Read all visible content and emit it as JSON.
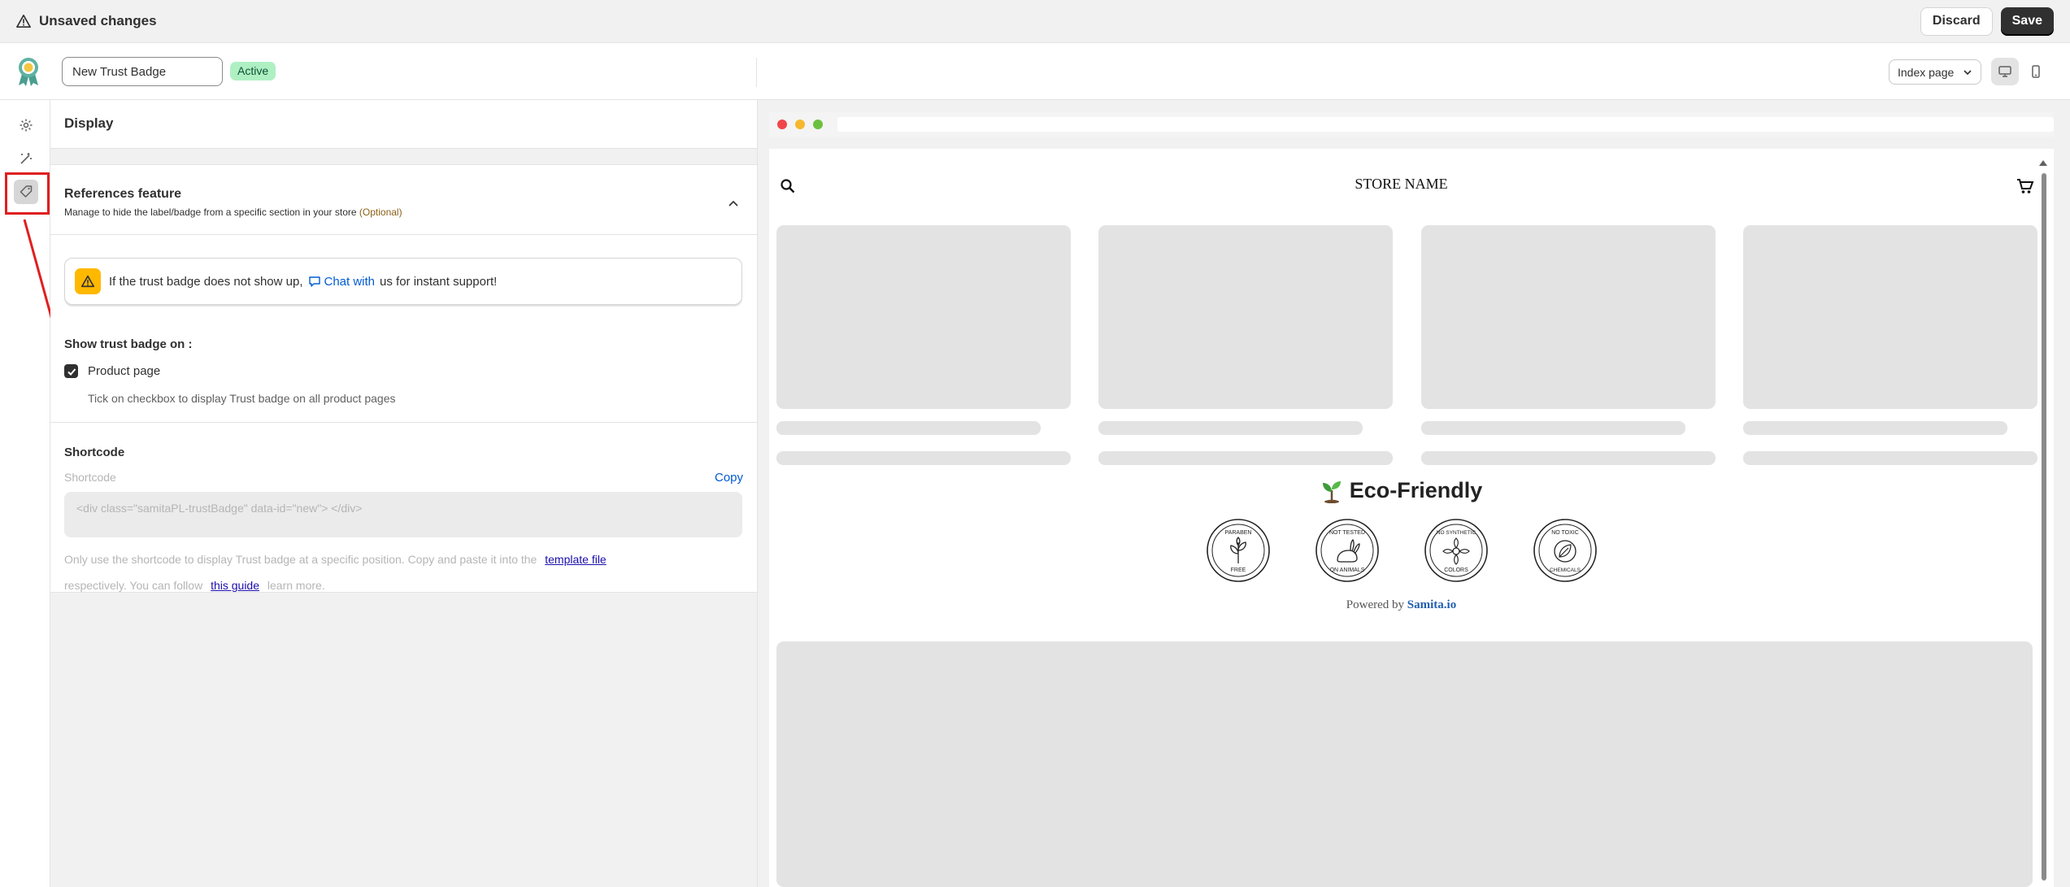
{
  "topbar": {
    "title": "Unsaved changes",
    "discard_label": "Discard",
    "save_label": "Save"
  },
  "header": {
    "badge_name": "New Trust Badge",
    "status": "Active",
    "page_select": "Index page",
    "devices": [
      "desktop-icon",
      "mobile-icon"
    ]
  },
  "rail": {
    "items": [
      "gear-icon",
      "magic-wand-icon",
      "tag-icon"
    ],
    "selected": 2
  },
  "panel": {
    "display_title": "Display",
    "references": {
      "title": "References feature",
      "subtitle": "Manage to hide the label/badge from a specific section in your store",
      "optional": "(Optional)"
    },
    "info": {
      "text_before": "If the trust badge does not show up,",
      "link": "Chat with",
      "text_after": "us for instant support!"
    },
    "show_on_title": "Show trust badge on :",
    "checkbox": {
      "label": "Product page",
      "checked": true,
      "help": "Tick on checkbox to display Trust badge on all product pages"
    },
    "shortcode": {
      "title": "Shortcode",
      "label": "Shortcode",
      "copy_label": "Copy",
      "value": "<div class=\"samitaPL-trustBadge\" data-id=\"new\"> </div>",
      "note_part1": "Only use the shortcode to display Trust badge at a specific position. Copy and paste it into the",
      "note_link1": "template file",
      "note_part2": "respectively. You can follow",
      "note_link2": "this guide",
      "note_part3": "learn more."
    }
  },
  "preview": {
    "store_name": "STORE NAME",
    "eco_title": "Eco-Friendly",
    "badges": [
      {
        "top": "PARABEN",
        "bottom": "FREE"
      },
      {
        "top": "NOT TESTED",
        "bottom": "ON ANIMALS"
      },
      {
        "top": "NO SYNTHETIC",
        "bottom": "COLORS"
      },
      {
        "top": "NO TOXIC",
        "bottom": "CHEMICALS"
      }
    ],
    "powered_by": "Powered by",
    "powered_brand": "Samita.io"
  },
  "colors": {
    "accent_red": "#e01f1f",
    "link_blue": "#005bd3",
    "active_badge": "#aff0c3",
    "warning": "#ffb800"
  }
}
